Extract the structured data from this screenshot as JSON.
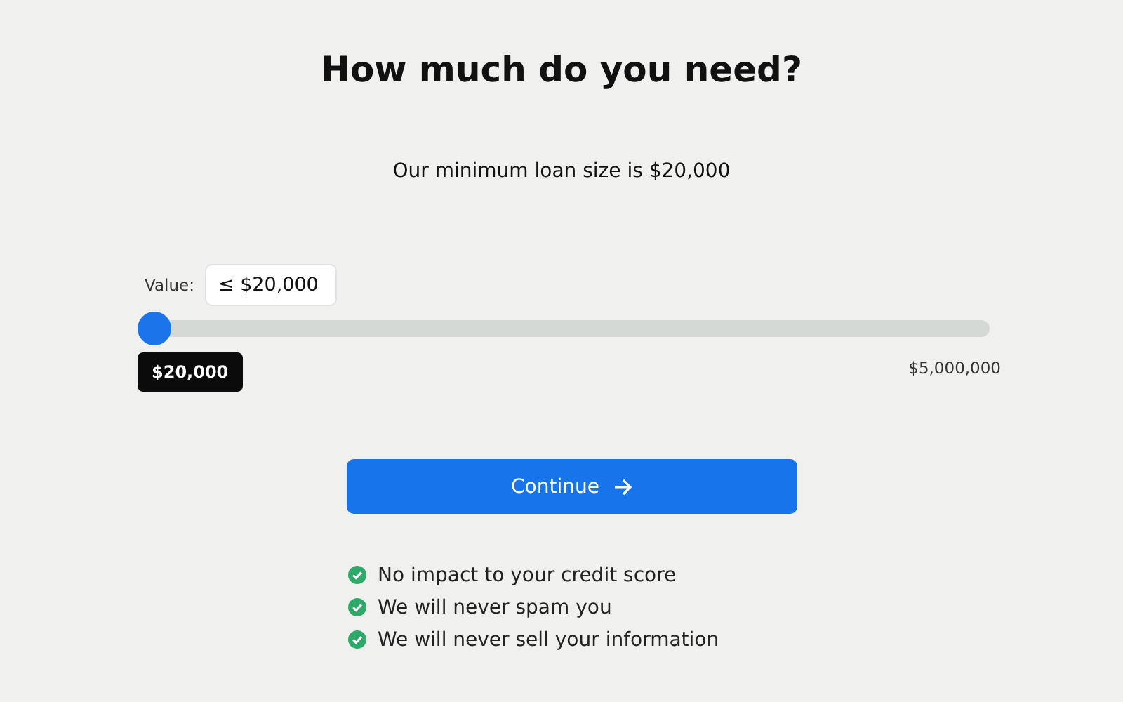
{
  "title": "How much do you need?",
  "subtitle": "Our minimum loan size is $20,000",
  "amount": {
    "label": "Value:",
    "value": "≤ $20,000",
    "level": 0,
    "thumb_label": "$20,000",
    "max_label": "$5,000,000"
  },
  "button": {
    "label": "Continue"
  },
  "benefits": [
    "No impact to your credit score",
    "We will never spam you",
    "We will never sell your information"
  ]
}
